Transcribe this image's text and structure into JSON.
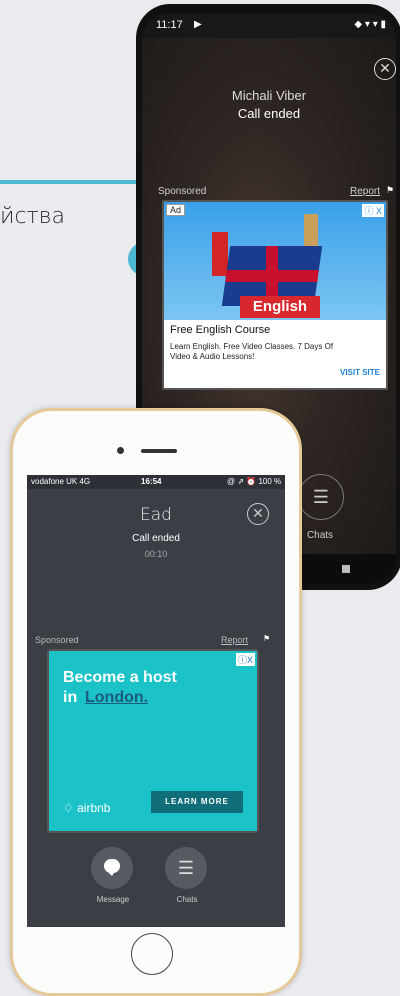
{
  "side_text": "йства",
  "android": {
    "status_time": "11:17",
    "status_play": "▶",
    "status_icons": "◆ ▾ ▾ ▮",
    "contact_name": "Michali Viber",
    "call_status": "Call ended",
    "sponsored_label": "Sponsored",
    "report_label": "Report",
    "close_icon": "✕",
    "ad": {
      "badge": "Ad",
      "close_badge": "ⓘ X",
      "image_text": "English",
      "title": "Free English Course",
      "description": "Learn English. Free Video Classes. 7 Days Of Video & Audio Lessons!",
      "cta": "VISIT SITE"
    },
    "chats_label": "Chats"
  },
  "iphone": {
    "carrier": "vodafone UK  4G",
    "time": "16:54",
    "battery": "@ ⇗ ⏰ 100 %",
    "contact_name": "Ead",
    "call_status": "Call ended",
    "duration": "00:10",
    "sponsored_label": "Sponsored",
    "report_label": "Report",
    "close_icon": "✕",
    "ad": {
      "close_badge": "ⓘX",
      "headline_line1": "Become a host",
      "headline_in": "in",
      "headline_city": "London.",
      "brand": "airbnb",
      "cta": "LEARN MORE",
      "accent_color": "#1bc3c9"
    },
    "message_label": "Message",
    "chats_label": "Chats"
  },
  "colors": {
    "pointer": "#4fb8d2"
  }
}
